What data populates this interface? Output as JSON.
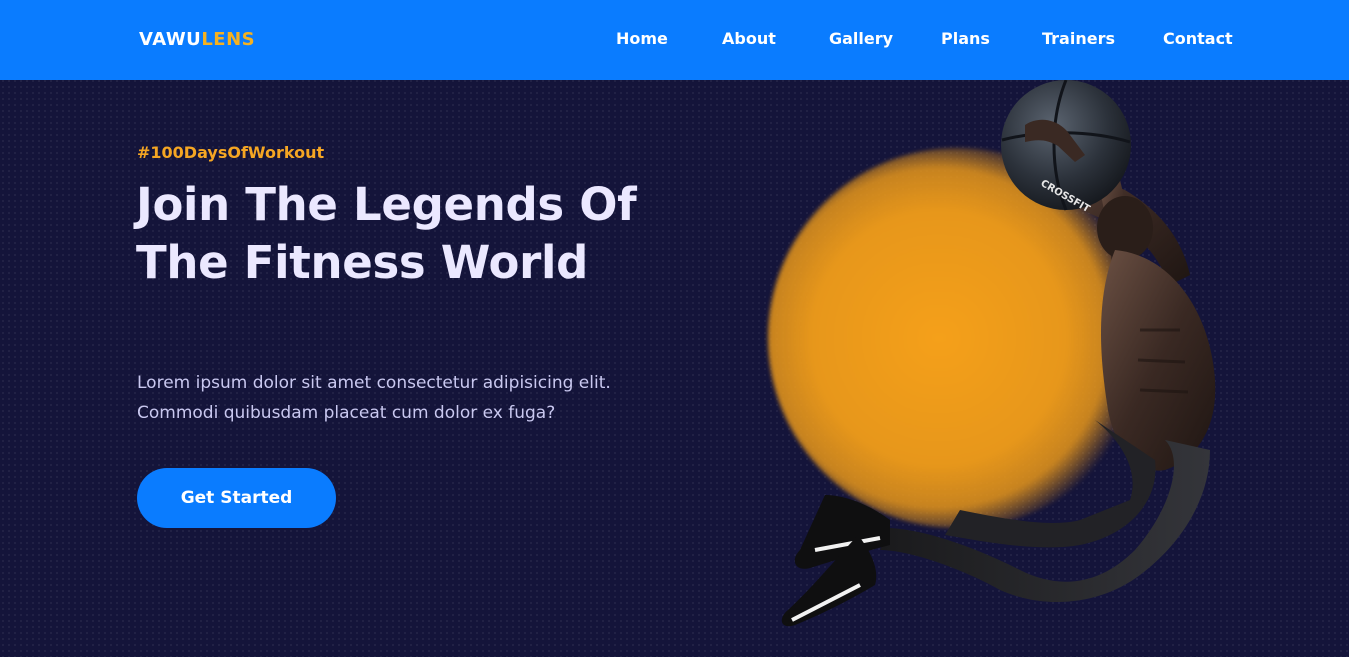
{
  "brand": {
    "logo_main": "VAWU",
    "logo_accent": "LENS"
  },
  "nav": {
    "items": [
      {
        "label": "Home"
      },
      {
        "label": "About"
      },
      {
        "label": "Gallery"
      },
      {
        "label": "Plans"
      },
      {
        "label": "Trainers"
      },
      {
        "label": "Contact"
      }
    ]
  },
  "hero": {
    "hashtag": "#100DaysOfWorkout",
    "title": "Join The Legends Of The Fitness World",
    "text": "Lorem ipsum dolor sit amet consectetur adipisicing elit. Commodi quibusdam placeat cum dolor ex fuga?",
    "cta_label": "Get Started",
    "ball_text": "CROSSFIT"
  },
  "colors": {
    "nav_bg": "#0a7cff",
    "page_bg": "#14143a",
    "accent": "#f5a623",
    "cta_bg": "#0a7cff",
    "glow": "#e7971b"
  },
  "icons": {
    "hero_image": "athlete-with-medicine-ball"
  }
}
